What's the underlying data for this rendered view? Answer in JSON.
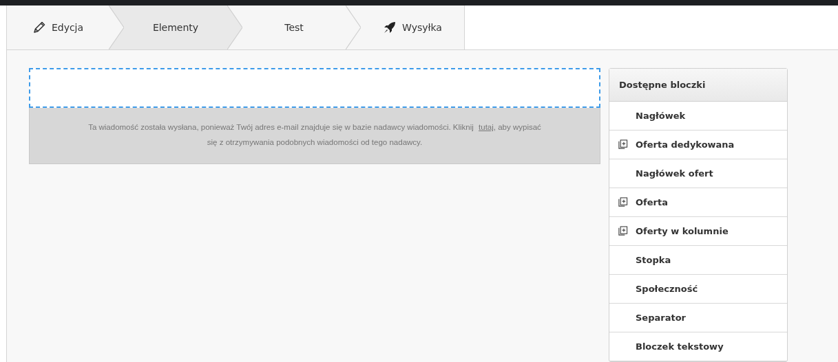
{
  "steps": [
    {
      "label": "Edycja",
      "kind": "edit",
      "selected": false
    },
    {
      "label": "Elementy",
      "kind": "plain",
      "selected": true
    },
    {
      "label": "Test",
      "kind": "plain",
      "selected": false
    },
    {
      "label": "Wysyłka",
      "kind": "send",
      "selected": false
    }
  ],
  "footer_note": {
    "before": "Ta wiadomość została wysłana, ponieważ Twój adres e-mail znajduje się w bazie nadawcy wiadomości. Kliknij ",
    "link": "tutaj",
    "after": ", aby wypisać się z otrzymywania podobnych wiadomości od tego nadawcy."
  },
  "blocks_panel": {
    "title": "Dostępne bloczki",
    "items": [
      {
        "label": "Nagłówek",
        "kind": "single"
      },
      {
        "label": "Oferta dedykowana",
        "kind": "group"
      },
      {
        "label": "Nagłówek ofert",
        "kind": "single"
      },
      {
        "label": "Oferta",
        "kind": "group"
      },
      {
        "label": "Oferty w kolumnie",
        "kind": "group"
      },
      {
        "label": "Stopka",
        "kind": "single"
      },
      {
        "label": "Społeczność",
        "kind": "single"
      },
      {
        "label": "Separator",
        "kind": "single"
      },
      {
        "label": "Bloczek tekstowy",
        "kind": "single"
      }
    ]
  }
}
